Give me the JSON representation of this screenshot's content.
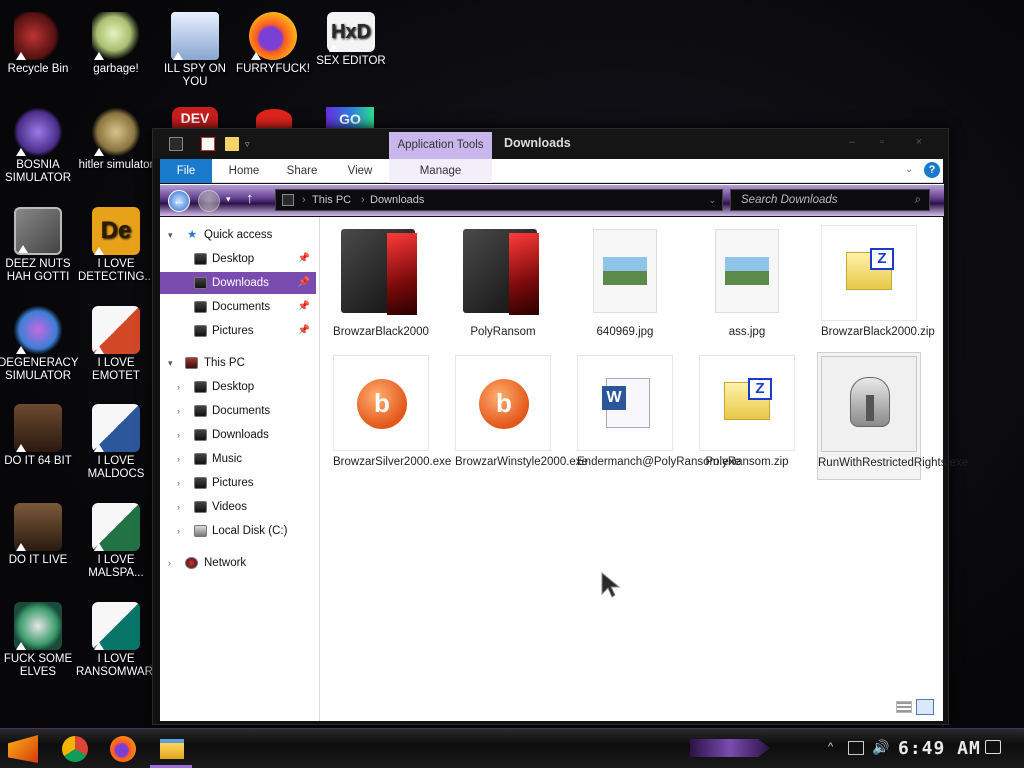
{
  "desktop": {
    "icons": [
      {
        "label": "Recycle Bin"
      },
      {
        "label": "garbage!"
      },
      {
        "label": "ILL SPY ON YOU"
      },
      {
        "label": "FURRYFUCK!"
      },
      {
        "label": "SEX EDITOR"
      },
      {
        "label": "BOSNIA SIMULATOR"
      },
      {
        "label": "hitler simulator"
      },
      {
        "label": "DEEZ NUTS HAH GOTTI"
      },
      {
        "label": "I LOVE DETECTING..."
      },
      {
        "label": "DEGENERACY SIMULATOR"
      },
      {
        "label": "I LOVE EMOTET"
      },
      {
        "label": "DO IT 64 BIT"
      },
      {
        "label": "I LOVE MALDOCS"
      },
      {
        "label": "DO IT LIVE"
      },
      {
        "label": "I LOVE MALSPA..."
      },
      {
        "label": "FUCK SOME ELVES"
      },
      {
        "label": "I LOVE RANSOMWARE"
      }
    ],
    "partial_labels": [
      "DEV",
      "GO"
    ]
  },
  "window": {
    "contextual_tab_group": "Application Tools",
    "title": "Downloads",
    "ribbon_tabs": [
      "File",
      "Home",
      "Share",
      "View",
      "Manage"
    ],
    "address": {
      "root": "This PC",
      "current": "Downloads"
    },
    "search_placeholder": "Search Downloads"
  },
  "navpane": {
    "quick_access": "Quick access",
    "quick_items": [
      "Desktop",
      "Downloads",
      "Documents",
      "Pictures"
    ],
    "this_pc": "This PC",
    "pc_items": [
      "Desktop",
      "Documents",
      "Downloads",
      "Music",
      "Pictures",
      "Videos",
      "Local Disk (C:)"
    ],
    "network": "Network"
  },
  "files": [
    {
      "name": "BrowzarBlack2000",
      "icon": "folder-dark-icon"
    },
    {
      "name": "PolyRansom",
      "icon": "folder-dark-icon"
    },
    {
      "name": "640969.jpg",
      "icon": "image-file-icon"
    },
    {
      "name": "ass.jpg",
      "icon": "image-file-icon"
    },
    {
      "name": "BrowzarBlack2000.zip",
      "icon": "zip-file-icon"
    },
    {
      "name": "BrowzarSilver2000.exe",
      "icon": "bing-exe-icon"
    },
    {
      "name": "BrowzarWinstyle2000.exe",
      "icon": "bing-exe-icon"
    },
    {
      "name": "Endermanch@PolyRansom.exe",
      "icon": "word-doc-icon"
    },
    {
      "name": "PolyRansom.zip",
      "icon": "zip-file-icon"
    },
    {
      "name": "RunWithRestrictedRights.exe",
      "icon": "helmet-exe-icon"
    }
  ],
  "taskbar": {
    "clock": "6:49 AM"
  },
  "colors": {
    "accent_purple": "#7a4cb0",
    "file_tab_blue": "#1979ca",
    "app_tools": "#c9b6ec"
  }
}
